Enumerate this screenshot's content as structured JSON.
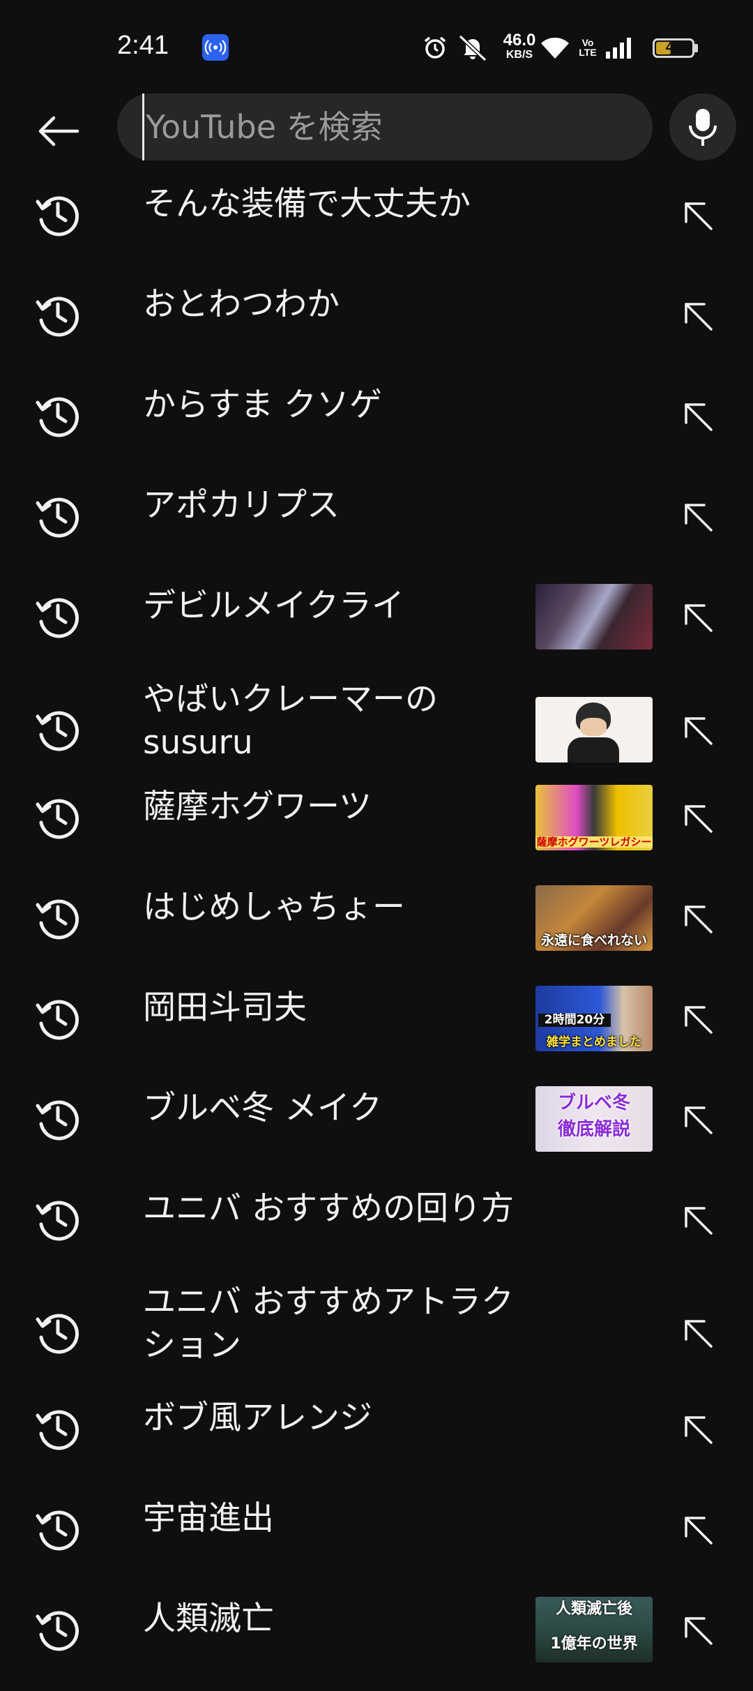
{
  "status_bar": {
    "time": "2:41",
    "net_speed_value": "46.0",
    "net_speed_unit": "KB/S",
    "volte_top": "Vo",
    "volte_bottom": "LTE",
    "battery_level": "42",
    "battery_fraction": 0.42
  },
  "search": {
    "placeholder": "YouTube を検索",
    "value": ""
  },
  "suggestions": [
    {
      "label": "そんな装備で大丈夫か",
      "thumbnail": false
    },
    {
      "label": "おとわつわか",
      "thumbnail": false
    },
    {
      "label": "からすま クソゲ",
      "thumbnail": false
    },
    {
      "label": "アポカリプス",
      "thumbnail": false
    },
    {
      "label": "デビルメイクライ",
      "thumbnail": true
    },
    {
      "label": "やばいクレーマーの susuru",
      "thumbnail": true
    },
    {
      "label": "薩摩ホグワーツ",
      "thumbnail": true,
      "thumb_caption": "薩摩ホグワーツレガシー"
    },
    {
      "label": "はじめしゃちょー",
      "thumbnail": true,
      "thumb_caption": "永遠に食べれない"
    },
    {
      "label": "岡田斗司夫",
      "thumbnail": true,
      "thumb_caption": "雑学まとめました",
      "thumb_caption_2": "2時間20分"
    },
    {
      "label": "ブルベ冬 メイク",
      "thumbnail": true,
      "thumb_caption": "ブルベ冬",
      "thumb_caption_2": "徹底解説"
    },
    {
      "label": "ユニバ おすすめの回り方",
      "thumbnail": false
    },
    {
      "label": "ユニバ おすすめアトラクション",
      "thumbnail": false
    },
    {
      "label": "ボブ風アレンジ",
      "thumbnail": false
    },
    {
      "label": "宇宙進出",
      "thumbnail": false
    },
    {
      "label": "人類滅亡",
      "thumbnail": true,
      "thumb_caption": "人類滅亡後",
      "thumb_caption_2": "1億年の世界"
    }
  ],
  "icons": {
    "back": "arrow-left-icon",
    "mic": "microphone-icon",
    "history": "history-clock-icon",
    "fill": "arrow-up-left-icon"
  }
}
